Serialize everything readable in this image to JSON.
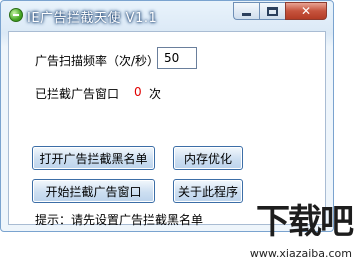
{
  "window": {
    "title": "IE广告拦截天使 V1.1"
  },
  "settings": {
    "freq_label": "广告扫描频率（次/秒）",
    "freq_value": "50",
    "blocked_label": "已拦截广告窗口",
    "blocked_count": "0",
    "blocked_unit": "次"
  },
  "buttons": {
    "open_blacklist": "打开广告拦截黑名单",
    "optimize_memory": "内存优化",
    "start_blocking": "开始拦截广告窗口",
    "about": "关于此程序"
  },
  "hint": "提示：请先设置广告拦截黑名单",
  "watermark": {
    "logo": "下载吧",
    "url": "www.xiazaiba.com"
  },
  "icons": {
    "app": "app-icon",
    "minimize": "minimize-icon",
    "maximize": "maximize-icon",
    "close": "close-icon"
  },
  "colors": {
    "count_red": "#e00000",
    "title_text": "#ffffff",
    "window_border": "#7aa3cf"
  }
}
